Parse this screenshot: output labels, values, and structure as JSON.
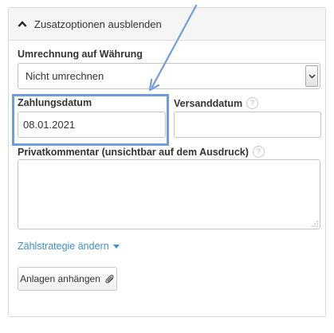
{
  "panel": {
    "toggle_label": "Zusatzoptionen ausblenden"
  },
  "currency": {
    "label": "Umrechnung auf Währung",
    "selected": "Nicht umrechnen"
  },
  "payment_date": {
    "label": "Zahlungsdatum",
    "value": "08.01.2021"
  },
  "shipping_date": {
    "label": "Versanddatum",
    "value": "",
    "help_icon": "question-icon"
  },
  "private_comment": {
    "label": "Privatkommentar (unsichtbar auf dem Ausdruck)",
    "value": "",
    "help_icon": "question-icon"
  },
  "counting_strategy_link": "Zählstrategie ändern",
  "attach_button": {
    "label": "Anlagen anhängen",
    "icon": "paperclip-icon"
  },
  "colors": {
    "link": "#3d8fce",
    "highlight": "#6e9ddf",
    "border": "#c4c4c4"
  }
}
